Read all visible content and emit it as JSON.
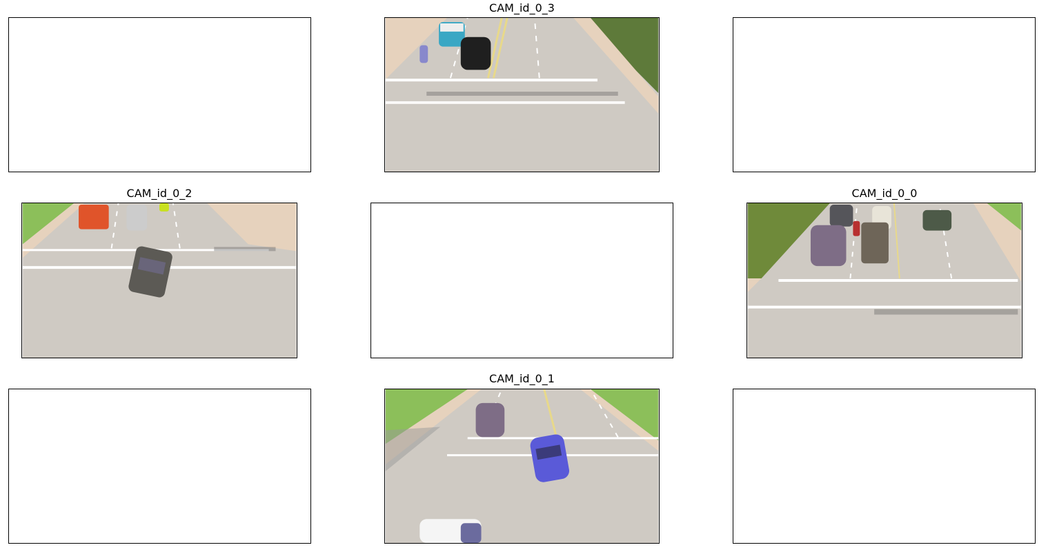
{
  "cameras": {
    "cam3": {
      "title": "CAM_id_0_3"
    },
    "cam2": {
      "title": "CAM_id_0_2"
    },
    "cam0": {
      "title": "CAM_id_0_0"
    },
    "cam1": {
      "title": "CAM_id_0_1"
    }
  },
  "colors": {
    "road": "#cfcac3",
    "sidewalk": "#e6d2bd",
    "grass": "#8cbf5a",
    "lane_marking": "#ffffff",
    "center_line": "#e8d98a"
  }
}
